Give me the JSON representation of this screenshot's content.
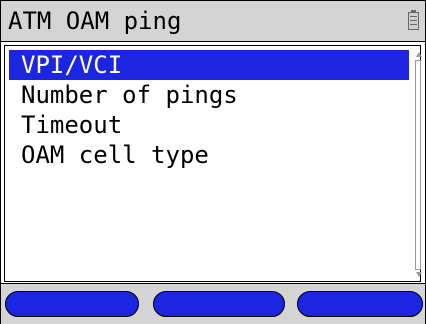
{
  "title": "ATM OAM ping",
  "menu": {
    "items": [
      {
        "label": "VPI/VCI",
        "selected": true
      },
      {
        "label": "Number of pings",
        "selected": false
      },
      {
        "label": "Timeout",
        "selected": false
      },
      {
        "label": "OAM cell type",
        "selected": false
      }
    ]
  },
  "softkeys": [
    {
      "label": ""
    },
    {
      "label": ""
    },
    {
      "label": ""
    }
  ],
  "colors": {
    "selection": "#1c26e0",
    "bar_background": "#d4d4d4"
  }
}
